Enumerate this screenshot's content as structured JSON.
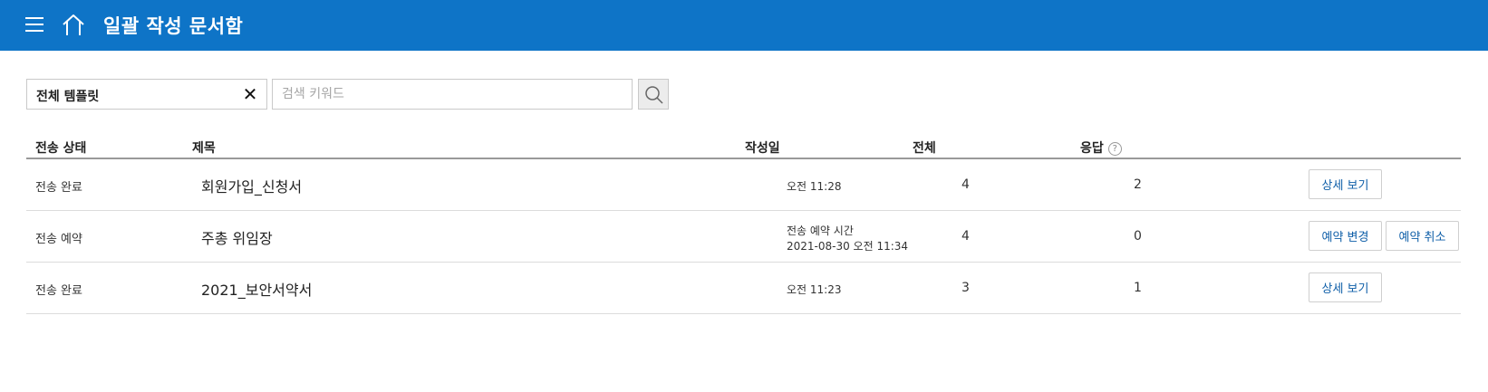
{
  "header": {
    "title": "일괄 작성 문서함",
    "menu_icon": "hamburger-menu-icon",
    "home_icon": "home-icon"
  },
  "filter": {
    "template_value": "전체 템플릿",
    "clear_glyph": "✕"
  },
  "search": {
    "placeholder": "검색 키워드",
    "value": "",
    "icon": "search-icon"
  },
  "table": {
    "columns": {
      "status": "전송 상태",
      "title": "제목",
      "date": "작성일",
      "total": "전체",
      "response": "응답"
    },
    "help_glyph": "?",
    "rows": [
      {
        "status": "전송 완료",
        "title": "회원가입_신청서",
        "date": "오전 11:28",
        "total": "4",
        "response": "2",
        "action": "상세 보기"
      },
      {
        "status": "전송 예약",
        "title": "주총 위임장",
        "date_label": "전송 예약 시간",
        "date": "2021-08-30 오전 11:34",
        "total": "4",
        "response": "0",
        "action": "예약 변경",
        "action2": "예약 취소"
      },
      {
        "status": "전송 완료",
        "title": "2021_보안서약서",
        "date": "오전 11:23",
        "total": "3",
        "response": "1",
        "action": "상세 보기"
      }
    ]
  },
  "colors": {
    "header_bg": "#0e74c7",
    "button_text": "#0e5ea8"
  }
}
